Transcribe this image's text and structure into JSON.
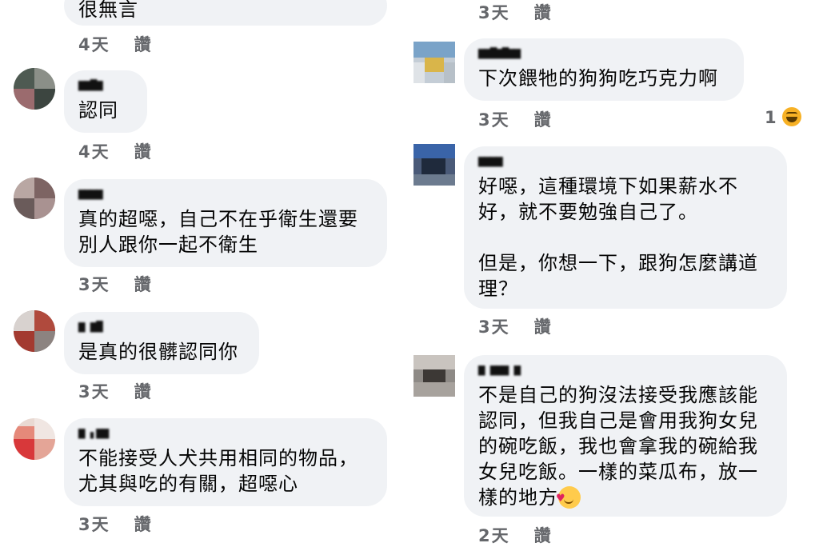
{
  "left": {
    "top_meta": {
      "time": "4天",
      "like": "讚"
    },
    "partial_text": "很無言",
    "comments": [
      {
        "name": "▆▆▇▆",
        "text": "認同",
        "time": "4天",
        "like": "讚"
      },
      {
        "name": "▆▆▆▆",
        "text": "真的超噁，自己不在乎衛生還要\n別人跟你一起不衛生",
        "time": "3天",
        "like": "讚"
      },
      {
        "name": "▆  ▆▇",
        "text": "是真的很髒認同你",
        "time": "3天",
        "like": "讚"
      },
      {
        "name": "▆ ▖▆▆",
        "text": "不能接受人犬共用相同的物品，\n尤其與吃的有關，超噁心",
        "time": "3天",
        "like": "讚"
      }
    ]
  },
  "right": {
    "top_meta": {
      "time": "3天",
      "like": "讚"
    },
    "comments": [
      {
        "name": "▆▆▇▆▇▆▆",
        "text": "下次餵牠的狗狗吃巧克力啊",
        "time": "3天",
        "like": "讚",
        "reaction_count": "1",
        "reaction_icon": "laugh-emoji-icon"
      },
      {
        "name": "▆▆▆▆",
        "text": "好噁，這種環境下如果薪水不\n好，就不要勉強自己了。\n\n但是，你想一下，跟狗怎麼講道\n理？",
        "time": "3天",
        "like": "讚"
      },
      {
        "name": "▆ ▆▆▆ ▆",
        "text": "不是自己的狗沒法接受我應該能\n認同，但我自己是會用我狗女兒\n的碗吃飯，我也會拿我的碗給我\n女兒吃飯。一樣的菜瓜布，放一\n樣的地方",
        "time": "2天",
        "like": "讚",
        "trailing_icon": "smiling-face-with-hearts-icon"
      }
    ]
  },
  "colors": {
    "bubble": "#f0f2f5",
    "meta": "#65676b",
    "text": "#050505"
  }
}
